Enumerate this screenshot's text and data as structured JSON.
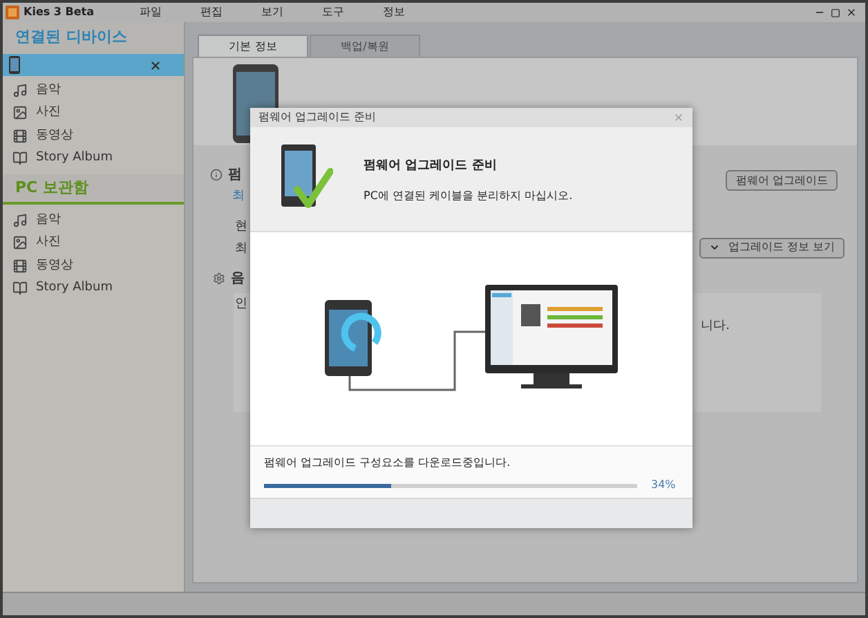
{
  "window": {
    "title": "Kies 3 Beta"
  },
  "menu": [
    "파일",
    "편집",
    "보기",
    "도구",
    "정보"
  ],
  "sidebar": {
    "connected": {
      "title": "연결된 디바이스",
      "device": {
        "selected": true
      },
      "items": [
        {
          "label": "음악",
          "kind": "music"
        },
        {
          "label": "사진",
          "kind": "photo"
        },
        {
          "label": "동영상",
          "kind": "video"
        },
        {
          "label": "Story Album",
          "kind": "album"
        }
      ]
    },
    "library": {
      "title": "PC 보관함",
      "items": [
        {
          "label": "음악",
          "kind": "music"
        },
        {
          "label": "사진",
          "kind": "photo"
        },
        {
          "label": "동영상",
          "kind": "video"
        },
        {
          "label": "Story Album",
          "kind": "album"
        }
      ]
    }
  },
  "tabs": [
    {
      "label": "기본 정보",
      "selected": true
    },
    {
      "label": "백업/복원",
      "selected": false
    }
  ],
  "main": {
    "firmware_heading": "펌",
    "link": "최",
    "line_1": "현",
    "line_2": "최",
    "section_heading": "음",
    "box_text_left": "인",
    "box_text_right": "니다.",
    "firmware_button": "펌웨어 업그레이드",
    "info_button": "업그레이드 정보 보기"
  },
  "dialog": {
    "title": "펌웨어 업그레이드 준비",
    "heading": "펌웨어 업그레이드 준비",
    "message": "PC에 연결된 케이블을 분리하지 마십시오.",
    "status": "펌웨어 업그레이드 구성요소를 다운로드중입니다.",
    "progress": {
      "level": 0.34,
      "reading": "34%"
    }
  }
}
